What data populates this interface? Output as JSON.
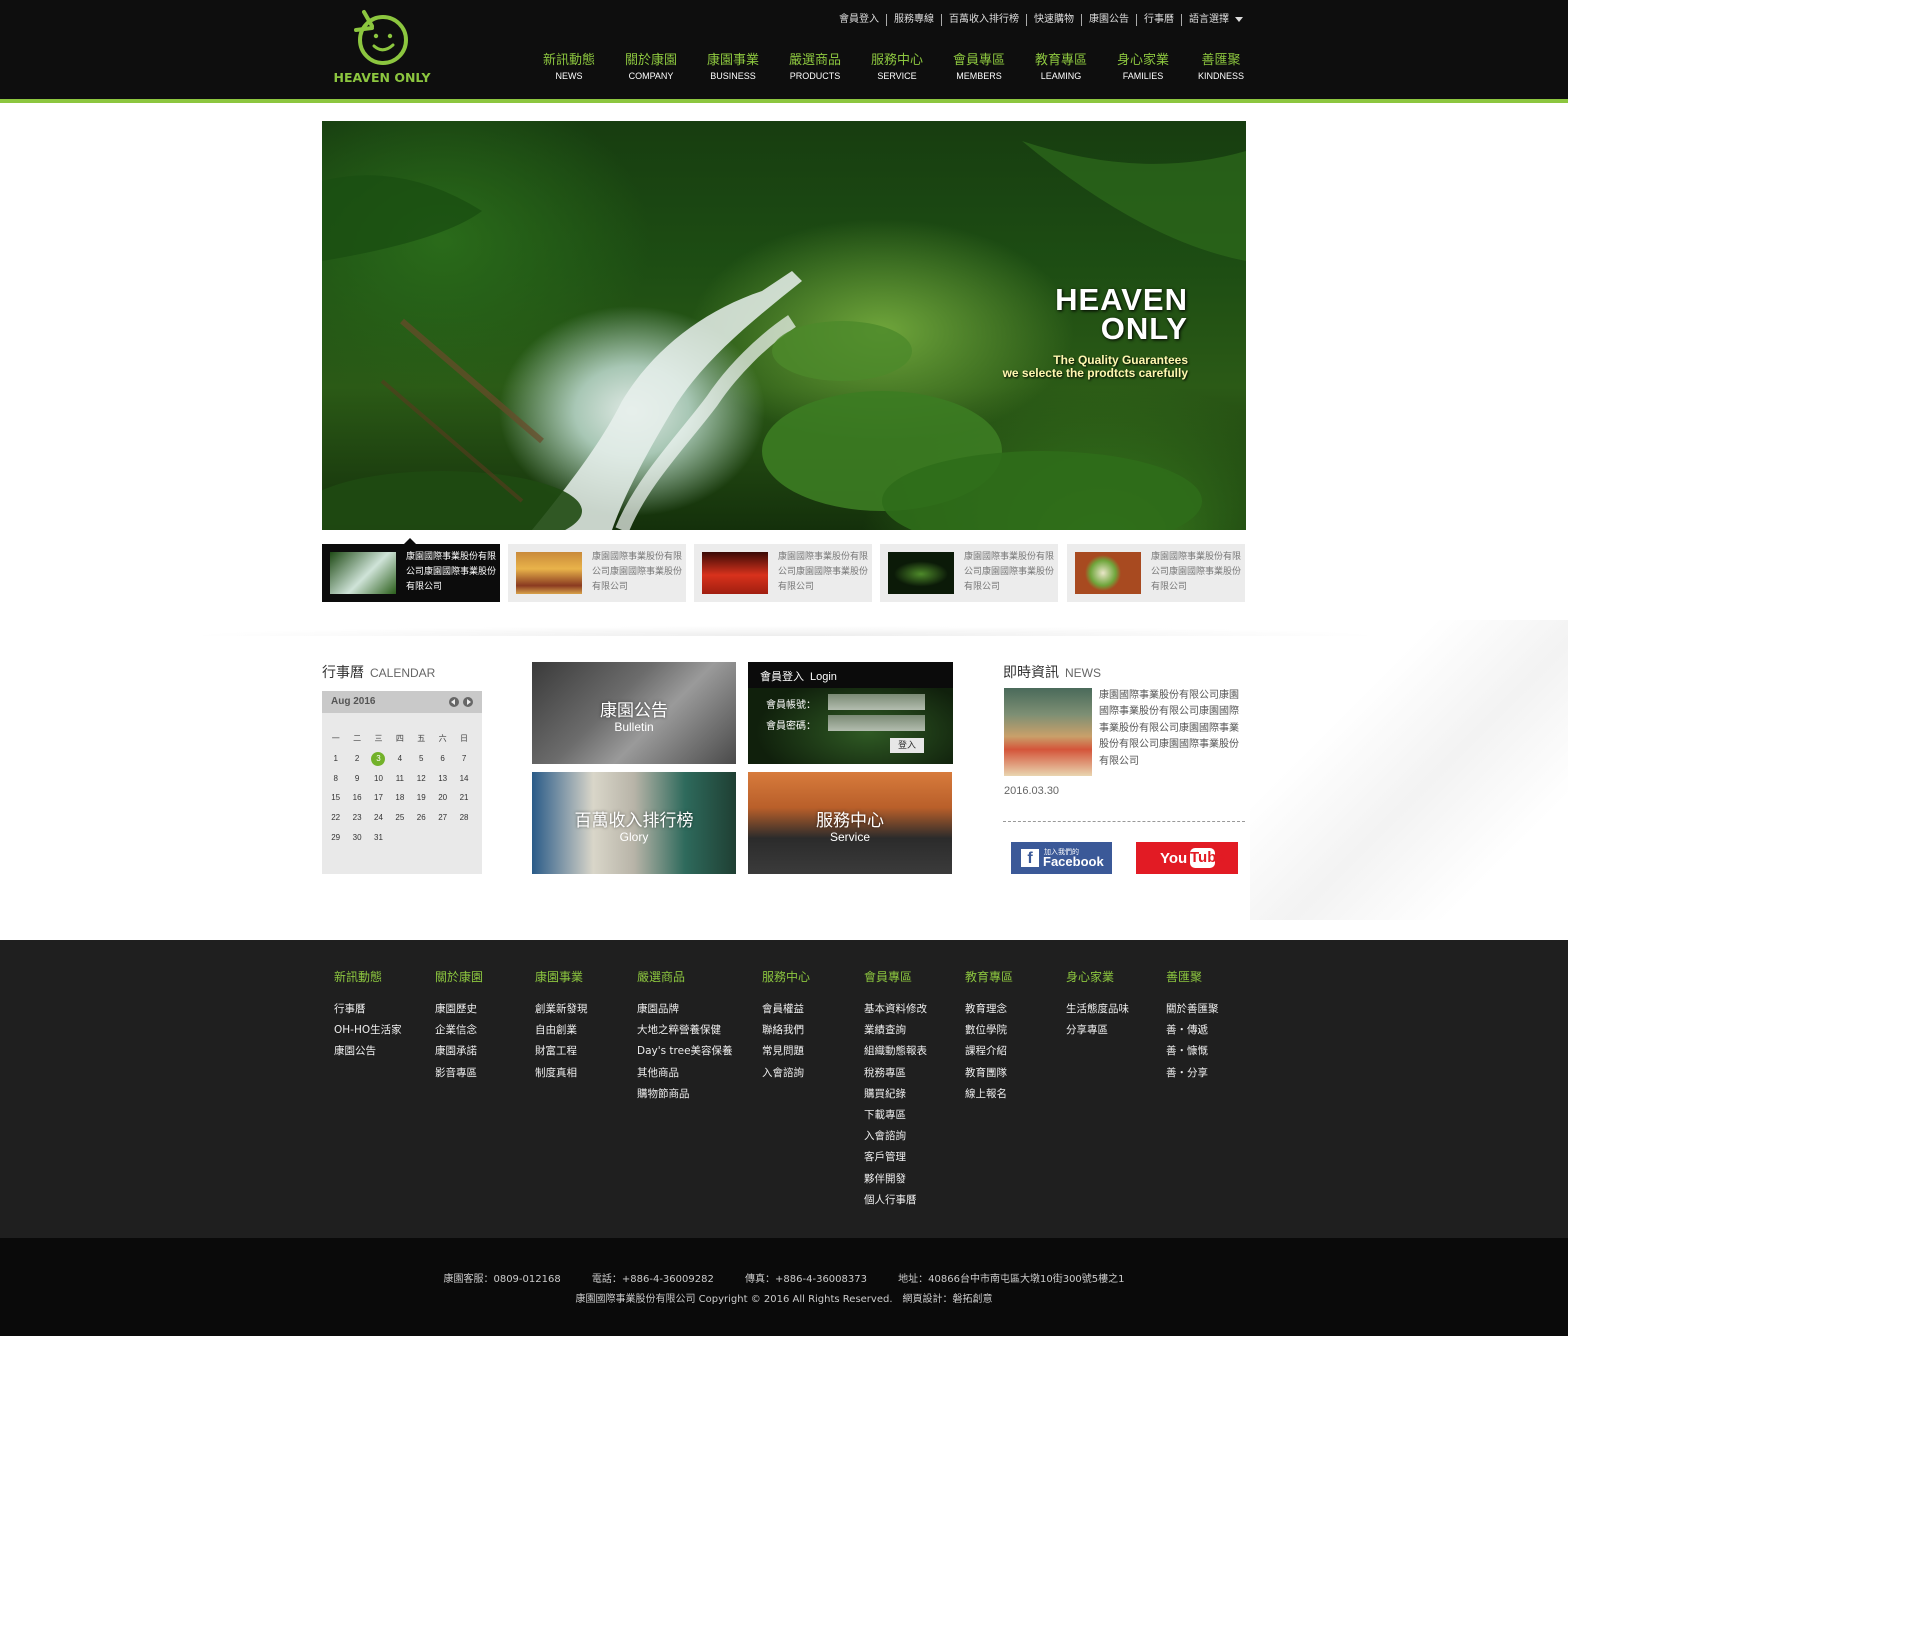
{
  "brand": {
    "logo_text": "HEAVEN ONLY",
    "accent": "#8cc63f"
  },
  "topnav": [
    "會員登入",
    "服務專線",
    "百萬收入排行榜",
    "快速購物",
    "康園公告",
    "行事曆",
    "語言選擇"
  ],
  "mainnav": [
    {
      "zh": "新訊動態",
      "en": "NEWS"
    },
    {
      "zh": "關於康園",
      "en": "COMPANY"
    },
    {
      "zh": "康園事業",
      "en": "BUSINESS"
    },
    {
      "zh": "嚴選商品",
      "en": "PRODUCTS"
    },
    {
      "zh": "服務中心",
      "en": "SERVICE"
    },
    {
      "zh": "會員專區",
      "en": "MEMBERS"
    },
    {
      "zh": "教育專區",
      "en": "LEAMING"
    },
    {
      "zh": "身心家業",
      "en": "FAMILIES"
    },
    {
      "zh": "善匯聚",
      "en": "KINDNESS"
    }
  ],
  "hero": {
    "title_line1": "HEAVEN",
    "title_line2": "ONLY",
    "sub_line1": "The Quality Guarantees",
    "sub_line2": "we selecte the prodtcts carefully"
  },
  "thumbs": [
    {
      "text": "康園國際事業股份有限公司康園國際事業股份有限公司"
    },
    {
      "text": "康園國際事業股份有限公司康園國際事業股份有限公司"
    },
    {
      "text": "康園國際事業股份有限公司康園國際事業股份有限公司"
    },
    {
      "text": "康園國際事業股份有限公司康園國際事業股份有限公司"
    },
    {
      "text": "康園國際事業股份有限公司康園國際事業股份有限公司"
    }
  ],
  "calendar": {
    "title_zh": "行事曆",
    "title_en": "CALENDAR",
    "month": "Aug 2016",
    "weekdays": [
      "一",
      "二",
      "三",
      "四",
      "五",
      "六",
      "日"
    ],
    "weeks": [
      [
        "1",
        "2",
        "3",
        "4",
        "5",
        "6",
        "7"
      ],
      [
        "8",
        "9",
        "10",
        "11",
        "12",
        "13",
        "14"
      ],
      [
        "15",
        "16",
        "17",
        "18",
        "19",
        "20",
        "21"
      ],
      [
        "22",
        "23",
        "24",
        "25",
        "26",
        "27",
        "28"
      ],
      [
        "29",
        "30",
        "31",
        "",
        "",
        "",
        ""
      ]
    ],
    "highlighted_day": "3"
  },
  "tiles": {
    "bulletin": {
      "zh": "康園公告",
      "en": "Bulletin"
    },
    "glory": {
      "zh": "百萬收入排行榜",
      "en": "Glory"
    },
    "service": {
      "zh": "服務中心",
      "en": "Service"
    }
  },
  "login": {
    "title_zh": "會員登入",
    "title_en": "Login",
    "account_label": "會員帳號：",
    "password_label": "會員密碼：",
    "button": "登入"
  },
  "news": {
    "title_zh": "即時資訊",
    "title_en": "NEWS",
    "text": "康園國際事業股份有限公司康園國際事業股份有限公司康園國際事業股份有限公司康園國際事業股份有限公司康園國際事業股份有限公司",
    "date": "2016.03.30"
  },
  "social": {
    "fb_small": "加入我們的",
    "fb_big": "Facebook",
    "yt_you": "You",
    "yt_tube": "Tube"
  },
  "footer_cols": [
    {
      "head": "新訊動態",
      "links": [
        "行事曆",
        "OH-HO生活家",
        "康園公告"
      ]
    },
    {
      "head": "關於康園",
      "links": [
        "康園歷史",
        "企業信念",
        "康園承諾",
        "影音專區"
      ]
    },
    {
      "head": "康園事業",
      "links": [
        "創業新發現",
        "自由創業",
        "財富工程",
        "制度真相"
      ]
    },
    {
      "head": "嚴選商品",
      "links": [
        "康園品牌",
        "大地之粹營養保健",
        "Day's tree美容保養",
        "其他商品",
        "購物節商品"
      ]
    },
    {
      "head": "服務中心",
      "links": [
        "會員權益",
        "聯絡我們",
        "常見問題",
        "入會諮詢"
      ]
    },
    {
      "head": "會員專區",
      "links": [
        "基本資料修改",
        "業績查詢",
        "組織動態報表",
        "稅務專區",
        "購買紀錄",
        "下載專區",
        "入會諮詢",
        "客戶管理",
        "夥伴開發",
        "個人行事曆"
      ]
    },
    {
      "head": "教育專區",
      "links": [
        "教育理念",
        "數位學院",
        "課程介紹",
        "教育團隊",
        "線上報名"
      ]
    },
    {
      "head": "身心家業",
      "links": [
        "生活態度品味",
        "分享專區"
      ]
    },
    {
      "head": "善匯聚",
      "links": [
        "關於善匯聚",
        "善・傳遞",
        "善・慷慨",
        "善・分享"
      ]
    }
  ],
  "bottom": {
    "service": "康園客服：0809-012168",
    "phone": "電話：+886-4-36009282",
    "fax": "傳真：+886-4-36008373",
    "address": "地址：40866台中市南屯區大墩10街300號5樓之1",
    "copyright": "康園國際事業股份有限公司 Copyright © 2016 All Rights Reserved.　網頁設計：磐拓創意"
  }
}
